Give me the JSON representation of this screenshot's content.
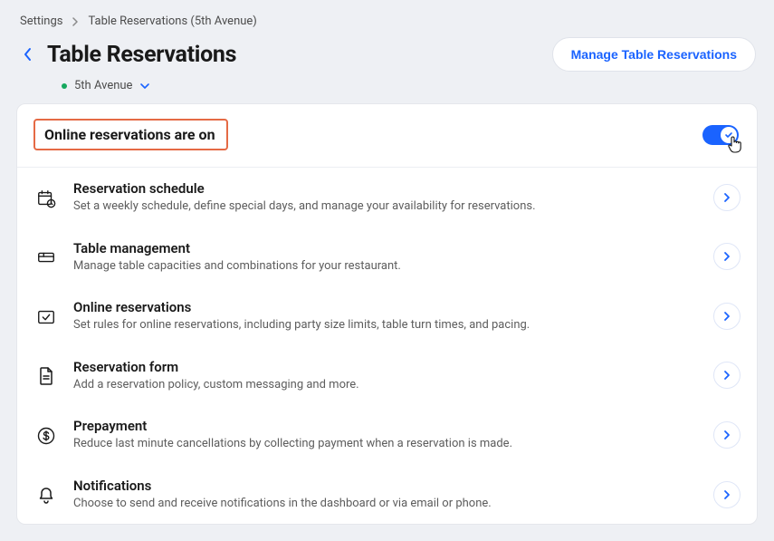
{
  "breadcrumb": {
    "root": "Settings",
    "current": "Table Reservations (5th Avenue)"
  },
  "header": {
    "title": "Table Reservations",
    "manage_btn": "Manage Table Reservations"
  },
  "location": {
    "name": "5th Avenue"
  },
  "toggle_section": {
    "label": "Online reservations are on",
    "on": true
  },
  "rows": [
    {
      "icon": "calendar-clock-icon",
      "title": "Reservation schedule",
      "desc": "Set a weekly schedule, define special days, and manage your availability for reservations."
    },
    {
      "icon": "table-icon",
      "title": "Table management",
      "desc": "Manage table capacities and combinations for your restaurant."
    },
    {
      "icon": "checkbox-icon",
      "title": "Online reservations",
      "desc": "Set rules for online reservations, including party size limits, table turn times, and pacing."
    },
    {
      "icon": "document-icon",
      "title": "Reservation form",
      "desc": "Add a reservation policy, custom messaging and more."
    },
    {
      "icon": "dollar-icon",
      "title": "Prepayment",
      "desc": "Reduce last minute cancellations by collecting payment when a reservation is made."
    },
    {
      "icon": "bell-icon",
      "title": "Notifications",
      "desc": "Choose to send and receive notifications in the dashboard or via email or phone."
    }
  ],
  "colors": {
    "accent": "#1a63ff",
    "highlight_border": "#e56a45",
    "success": "#15a85e"
  }
}
